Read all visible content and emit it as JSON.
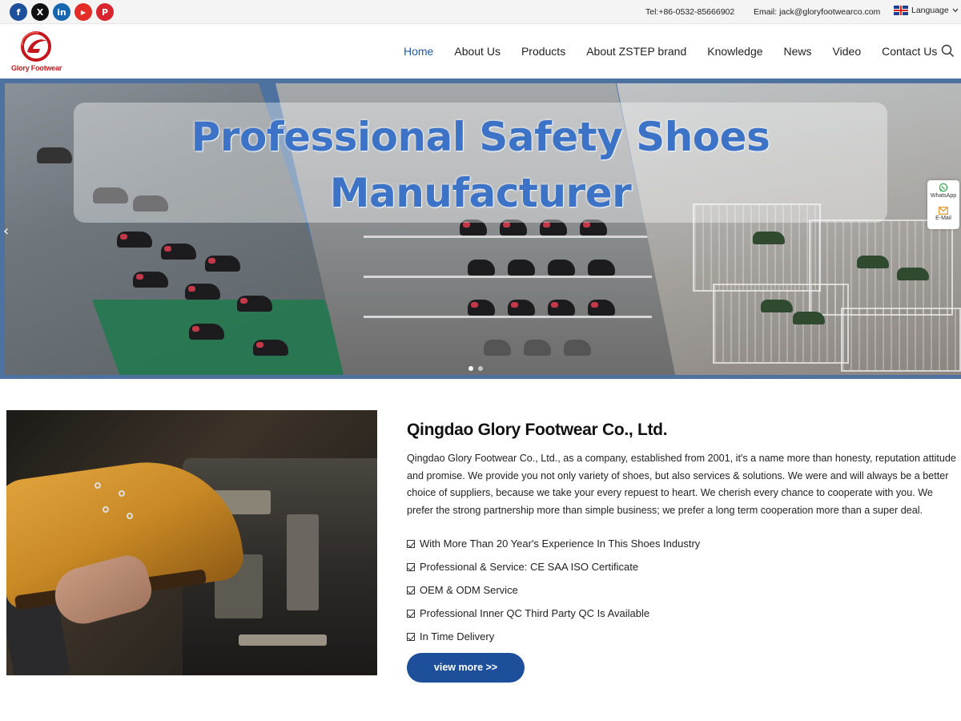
{
  "topbar": {
    "social": [
      {
        "icon": "facebook-icon",
        "glyph": "f"
      },
      {
        "icon": "x-twitter-icon",
        "glyph": "X"
      },
      {
        "icon": "linkedin-icon",
        "glyph": "in"
      },
      {
        "icon": "youtube-icon",
        "glyph": "▶"
      },
      {
        "icon": "pinterest-icon",
        "glyph": "P"
      }
    ],
    "tel": "Tel:+86-0532-85666902",
    "email": "Email: jack@gloryfootwearco.com",
    "language": "Language"
  },
  "header": {
    "logo_text": "Glory Footwear",
    "nav": [
      "Home",
      "About Us",
      "Products",
      "About ZSTEP brand",
      "Knowledge",
      "News",
      "Video",
      "Contact Us"
    ],
    "active": "Home"
  },
  "hero": {
    "title_line1": "Professional Safety Shoes",
    "title_line2": "Manufacturer",
    "prev_glyph": "‹"
  },
  "float_contact": {
    "whatsapp": "WhatsApp",
    "email": "E-Mail"
  },
  "about": {
    "title": "Qingdao Glory Footwear Co., Ltd.",
    "text": "Qingdao Glory Footwear Co., Ltd., as a company, established from 2001, it's a name more than honesty, reputation attitude and promise. We provide you not only variety of shoes, but also services & solutions. We were and will always be a better choice of suppliers, because we take your every repuest to heart. We cherish every chance to cooperate with you. We prefer the strong partnership more than simple business; we prefer a long term cooperation more than a super deal.",
    "features": [
      "With More Than 20 Year's Experience In This Shoes Industry",
      "Professional & Service: CE SAA ISO Certificate",
      "OEM & ODM Service",
      "Professional Inner QC Third Party QC Is Available",
      "In Time Delivery"
    ],
    "button": "view more >>"
  },
  "colors": {
    "accent": "#1d4f9a",
    "nav_active": "#1d5aa8",
    "hero_title": "#3d73c6",
    "logo_red": "#c4161c"
  }
}
